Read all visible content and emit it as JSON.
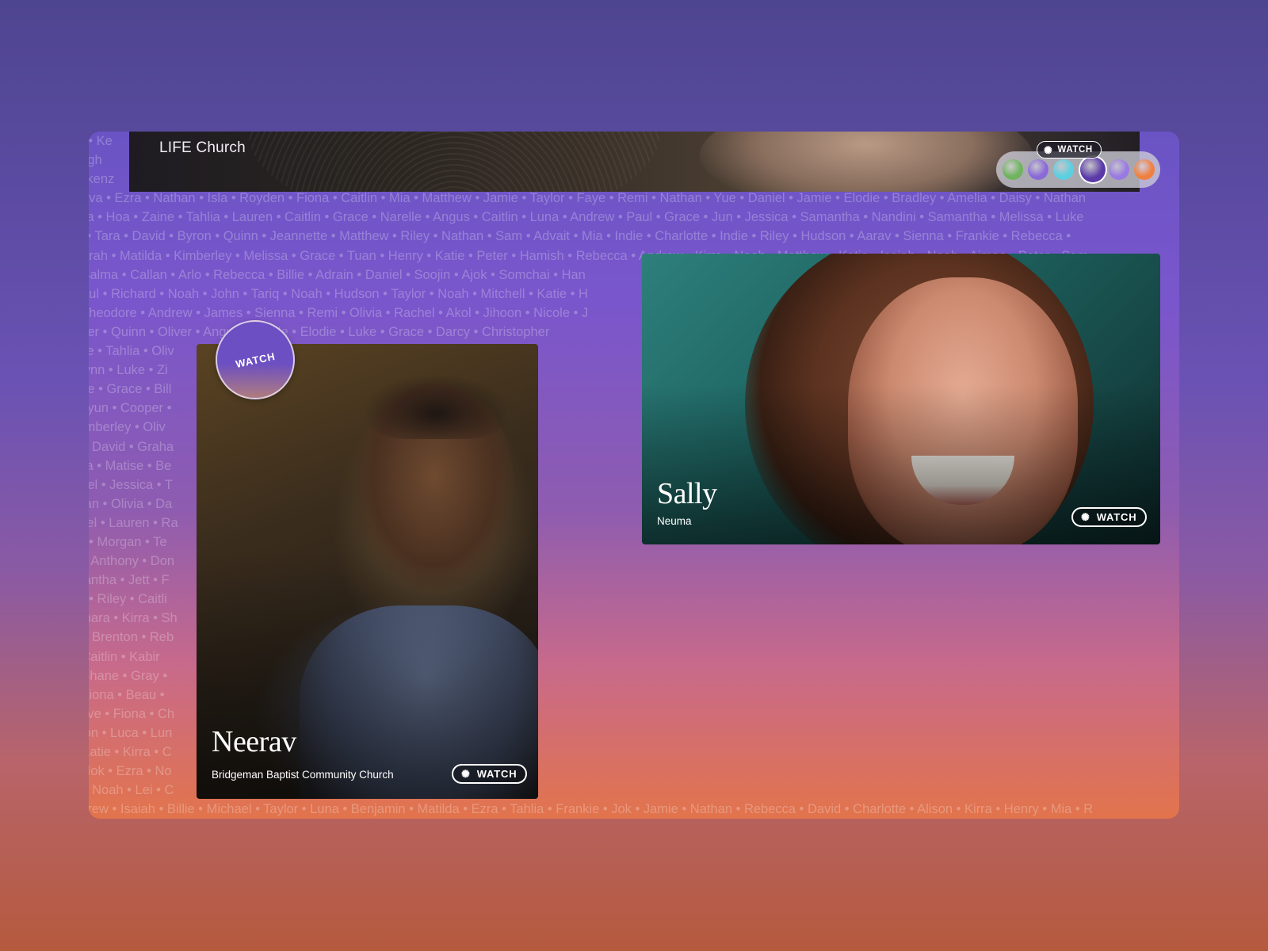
{
  "brand": {
    "name": "LIFE Church"
  },
  "color_picker": {
    "watch_label": "WATCH",
    "swatches": [
      {
        "name": "green-swatch",
        "color": "#6fb45e"
      },
      {
        "name": "violet-swatch",
        "color": "#8a6ad8"
      },
      {
        "name": "cyan-swatch",
        "color": "#5ad0e0"
      },
      {
        "name": "indigo-swatch",
        "color": "#5a3aa8",
        "selected": true
      },
      {
        "name": "lilac-swatch",
        "color": "#9a7ae2"
      },
      {
        "name": "orange-swatch",
        "color": "#f08040"
      }
    ]
  },
  "cards": {
    "neerav": {
      "name": "Neerav",
      "church": "Bridgeman Baptist Community Church",
      "watch_label": "WATCH",
      "circle_label": "WATCH"
    },
    "sally": {
      "name": "Sally",
      "church": "Neuma",
      "watch_label": "WATCH"
    }
  },
  "background_names": [
    "or • Ke",
    "ungh",
    "ackenz",
    "• Ava • Ezra • Nathan • Isla • Royden • Fiona • Caitlin • Mia • Matthew • Jamie • Taylor • Faye • Remi • Nathan • Yue • Daniel • Jamie • Elodie • Bradley • Amelia • Daisy • Nathan",
    "thia • Hoa • Zaine • Tahlia • Lauren • Caitlin • Grace • Narelle • Angus • Caitlin • Luna • Andrew • Paul • Grace • Jun • Jessica • Samantha • Nandini • Samantha • Melissa • Luke",
    "el • Tara • David • Byron • Quinn • Jeannette • Matthew • Riley • Nathan • Sam • Advait • Mia • Indie • Charlotte • Indie • Riley • Hudson • Aarav • Sienna • Frankie • Rebecca •",
    "Sarah • Matilda • Kimberley • Melissa • Grace • Tuan • Henry • Katie • Peter • Hamish • Rebecca • Andrew • Kirra • Noah • Matthew • Katie • Isaiah • Noah • Aimee • Peter • Sam",
    "• Salma • Callan • Arlo • Rebecca • Billie • Adrain • Daniel • Soojin • Ajok • Somchai • Han",
    "Paul • Richard • Noah • John • Tariq • Noah • Hudson • Taylor • Noah • Mitchell • Katie • H",
    "• Theodore • Andrew • James • Sienna • Remi • Olivia • Rachel • Akol • Jihoon • Nicole • J",
    "oper • Quinn • Oliver • Angus • Nicole • Elodie • Luke • Grace • Darcy • Christopher",
    "uke • Tahlia • Oliv",
    "Flynn • Luke • Zi",
    "ane • Grace • Bill",
    "ehyun • Cooper •",
    "Kimberley • Oliv",
    "h • David • Graha",
    "cca • Matise • Be",
    "hael • Jessica • T",
    "rgan • Olivia • Da",
    "azel • Lauren • Ra",
    "ily • Morgan • Te",
    "s • Anthony • Don",
    "mantha • Jett • F",
    "lly • Riley • Caitli",
    "amara • Kirra • Sh",
    "a • Brenton • Reb",
    "• Caitlin • Kabir",
    "• Shane • Gray •",
    "• Fiona • Beau •",
    "auve • Fiona • Ch",
    "yron • Luca • Lun",
    "• Katie • Kirra • C",
    "• Nok • Ezra • No",
    "a • Noah • Lei • C",
    "ndrew • Isaiah • Billie • Michael • Taylor • Luna • Benjamin • Matilda • Ezra • Tahlia • Frankie • Jok • Jamie • Nathan • Rebecca • David • Charlotte • Alison • Kirra • Henry • Mia • R"
  ]
}
